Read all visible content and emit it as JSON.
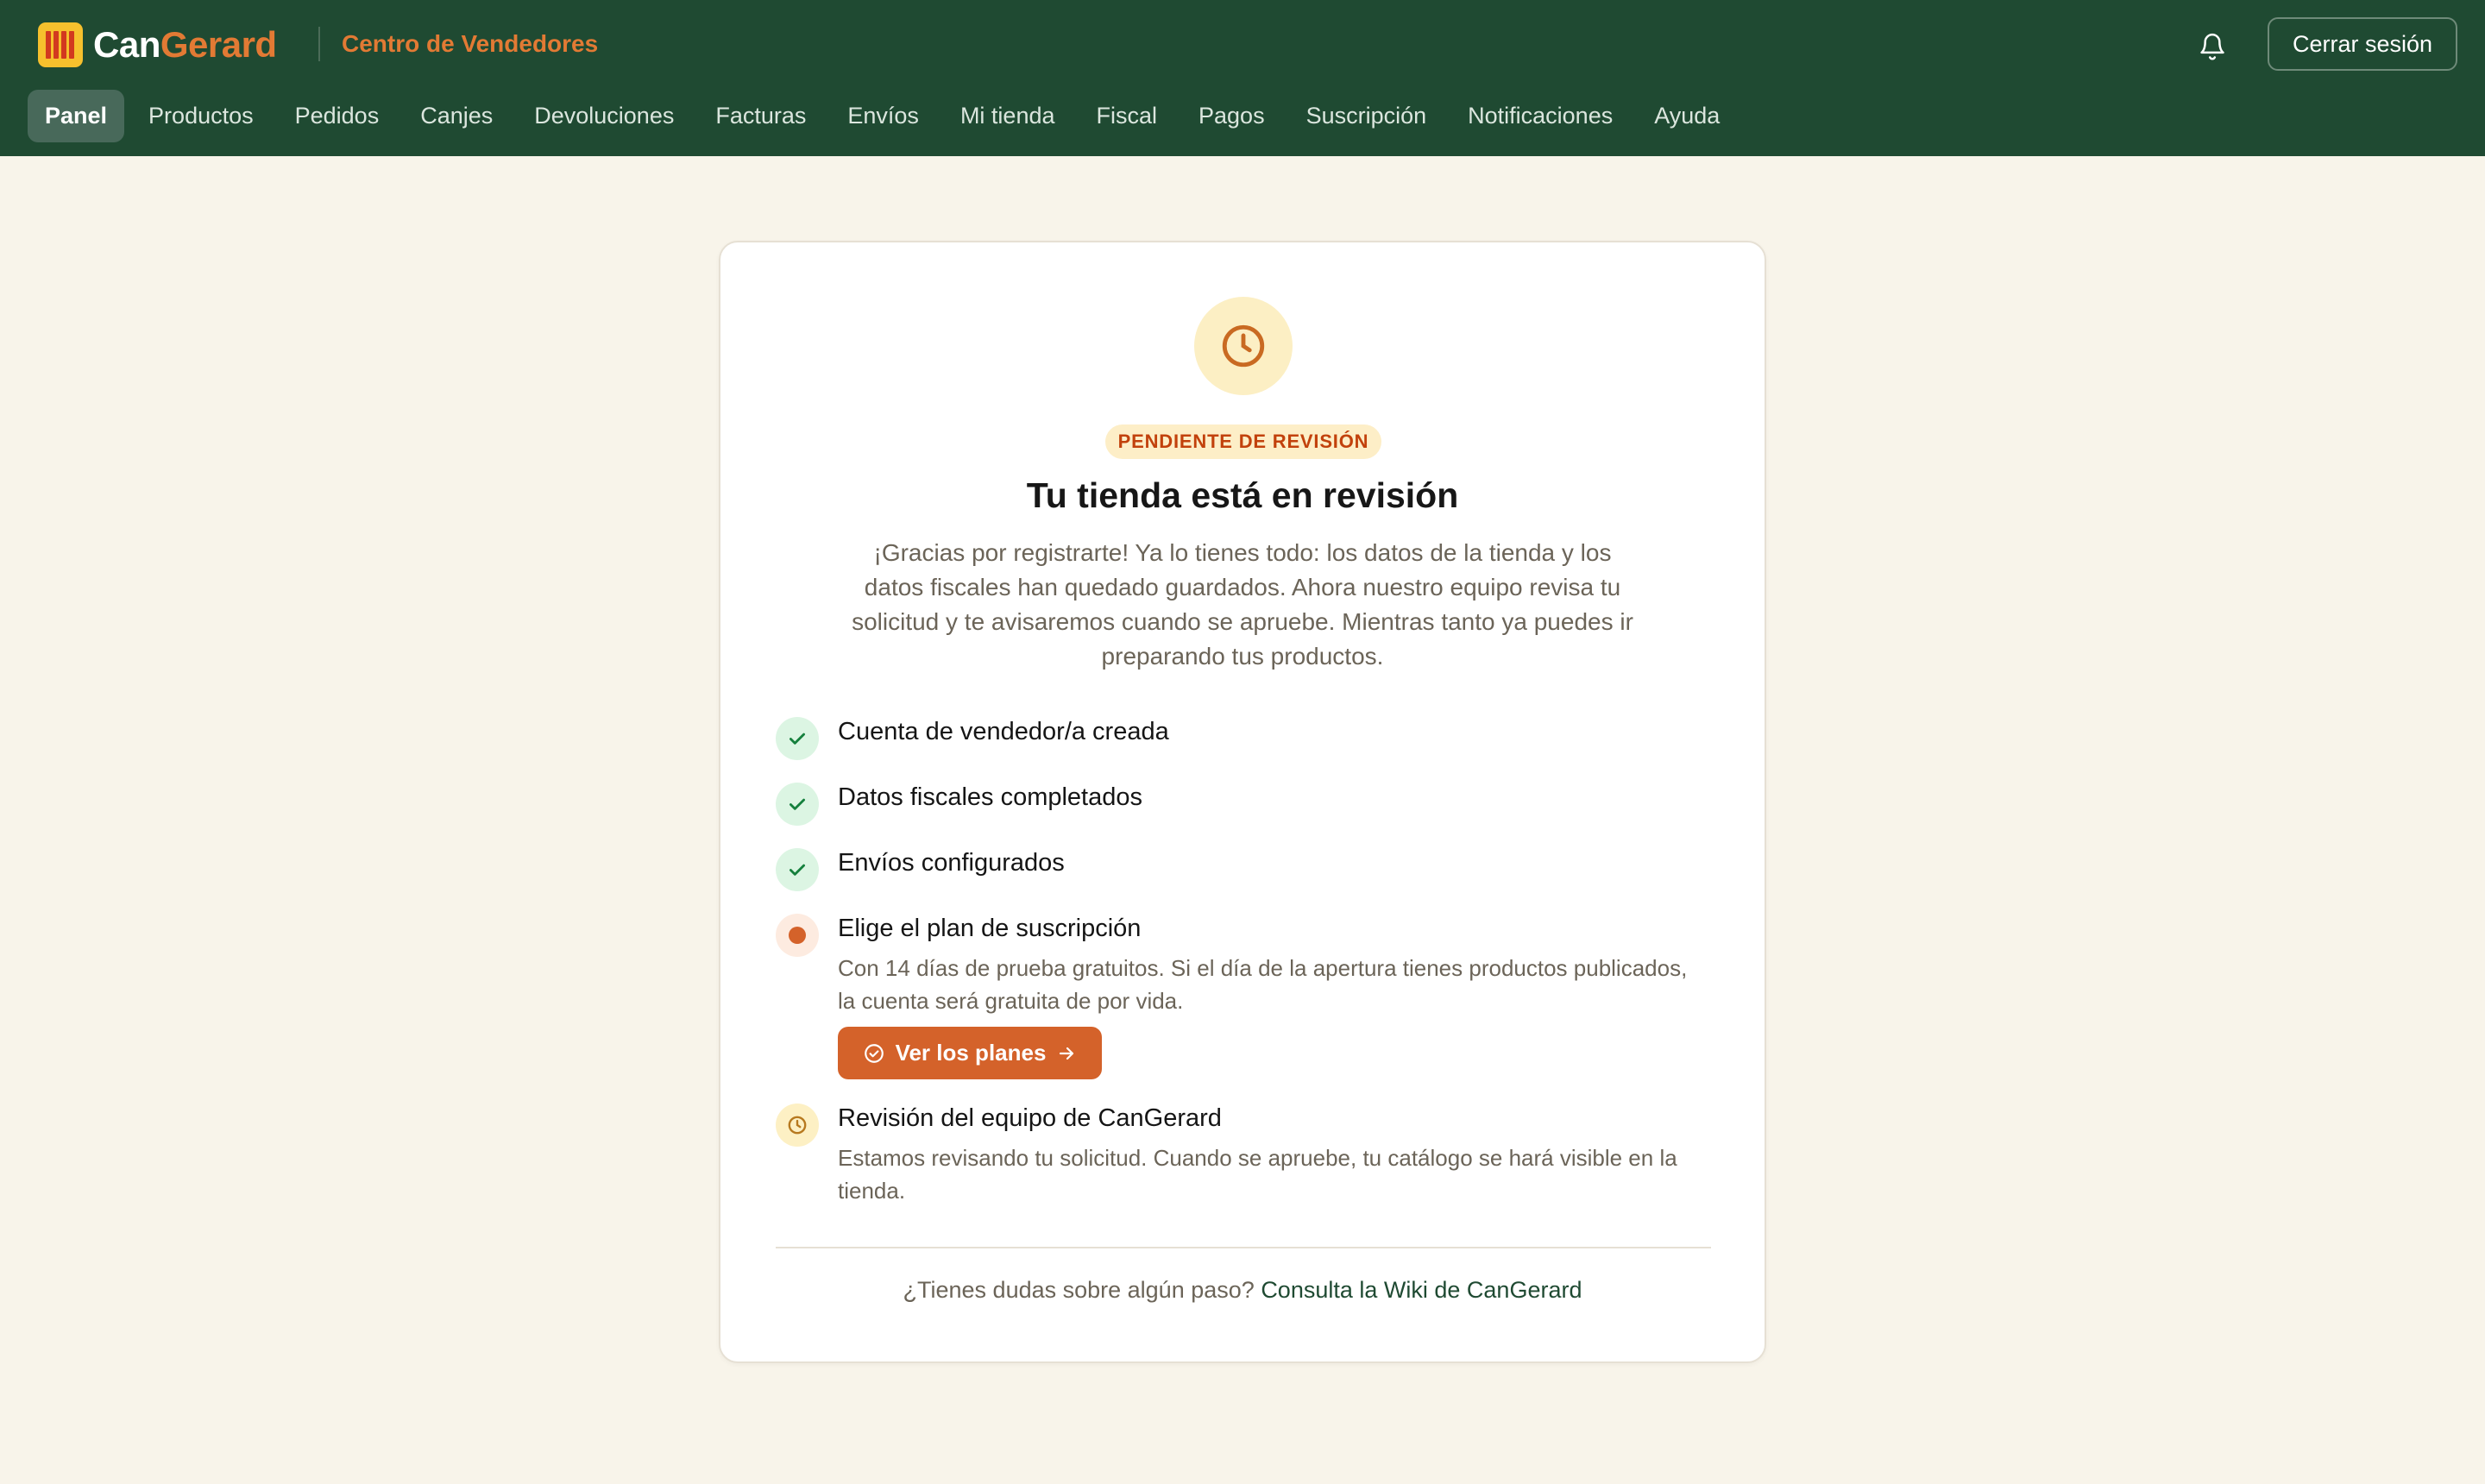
{
  "brand": {
    "name_part1": "Can",
    "name_part2": "Gerard",
    "subtitle": "Centro de Vendedores"
  },
  "header": {
    "logout_label": "Cerrar sesión",
    "bell_icon": "bell-icon"
  },
  "nav": {
    "items": [
      {
        "label": "Panel",
        "active": true
      },
      {
        "label": "Productos"
      },
      {
        "label": "Pedidos"
      },
      {
        "label": "Canjes"
      },
      {
        "label": "Devoluciones"
      },
      {
        "label": "Facturas"
      },
      {
        "label": "Envíos"
      },
      {
        "label": "Mi tienda"
      },
      {
        "label": "Fiscal"
      },
      {
        "label": "Pagos"
      },
      {
        "label": "Suscripción"
      },
      {
        "label": "Notificaciones"
      },
      {
        "label": "Ayuda"
      }
    ]
  },
  "status": {
    "icon": "clock-icon",
    "badge": "PENDIENTE DE REVISIÓN",
    "title": "Tu tienda está en revisión",
    "intro": "¡Gracias por registrarte! Ya lo tienes todo: los datos de la tienda y los datos fiscales han quedado guardados. Ahora nuestro equipo revisa tu solicitud y te avisaremos cuando se apruebe. Mientras tanto ya puedes ir preparando tus productos."
  },
  "steps": [
    {
      "state": "done",
      "icon": "check-icon",
      "title": "Cuenta de vendedor/a creada"
    },
    {
      "state": "done",
      "icon": "check-icon",
      "title": "Datos fiscales completados"
    },
    {
      "state": "done",
      "icon": "check-icon",
      "title": "Envíos configurados"
    },
    {
      "state": "current",
      "icon": "dot-icon",
      "title": "Elige el plan de suscripción",
      "desc": "Con 14 días de prueba gratuitos. Si el día de la apertura tienes productos publicados, la cuenta será gratuita de por vida.",
      "button_label": "Ver los planes"
    },
    {
      "state": "pending",
      "icon": "clock-icon",
      "title": "Revisión del equipo de CanGerard",
      "desc": "Estamos revisando tu solicitud. Cuando se apruebe, tu catálogo se hará visible en la tienda."
    }
  ],
  "help": {
    "text": "¿Tienes dudas sobre algún paso?",
    "link": "Consulta la Wiki de CanGerard"
  },
  "colors": {
    "header": "#1f4a32",
    "accent": "#d4622a",
    "background": "#f8f4ea",
    "success": "#16a34a"
  }
}
